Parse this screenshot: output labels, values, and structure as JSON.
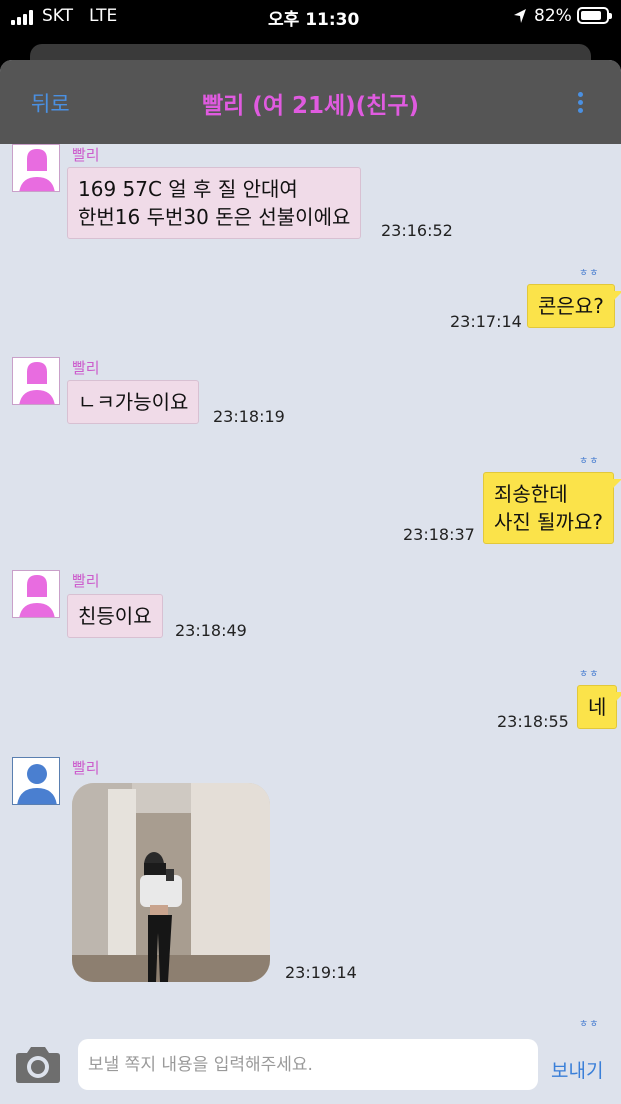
{
  "status_bar": {
    "carrier": "SKT",
    "network": "LTE",
    "time": "오후 11:30",
    "battery": "82%",
    "battery_level": 0.82
  },
  "header": {
    "back_label": "뒤로",
    "title": "빨리 (여 21세)(친구)",
    "menu_icon": "more-vertical-icon"
  },
  "messages": [
    {
      "direction": "in",
      "sender": "빨리",
      "text": "169 57C 얼 후 질 안대여\n한번16 두번30 돈은 선불이에요",
      "time": "23:16:52",
      "avatar_color": "#e86ce0"
    },
    {
      "direction": "out",
      "read": "ㅎㅎ",
      "text": "콘은요?",
      "time": "23:17:14"
    },
    {
      "direction": "in",
      "sender": "빨리",
      "text": "ㄴㅋ가능이요",
      "time": "23:18:19",
      "avatar_color": "#e86ce0"
    },
    {
      "direction": "out",
      "read": "ㅎㅎ",
      "text": "죄송한데\n사진 될까요?",
      "time": "23:18:37"
    },
    {
      "direction": "in",
      "sender": "빨리",
      "text": "친등이요",
      "time": "23:18:49",
      "avatar_color": "#e86ce0"
    },
    {
      "direction": "out",
      "read": "ㅎㅎ",
      "text": "네",
      "time": "23:18:55"
    },
    {
      "direction": "in",
      "sender": "빨리",
      "type": "photo",
      "time": "23:19:14",
      "avatar_color": "#4a7fd0"
    },
    {
      "direction": "out",
      "read": "ㅎㅎ"
    }
  ],
  "composer": {
    "placeholder": "보낼 쪽지 내용을 입력해주세요.",
    "send_label": "보내기",
    "camera_icon": "camera-icon"
  },
  "colors": {
    "header_bg": "#555555",
    "chat_bg": "#dde2ec",
    "incoming_bubble": "#f0dbe8",
    "outgoing_bubble": "#fbe34a",
    "accent": "#4a90e2",
    "sender_name": "#cc5ccc"
  }
}
